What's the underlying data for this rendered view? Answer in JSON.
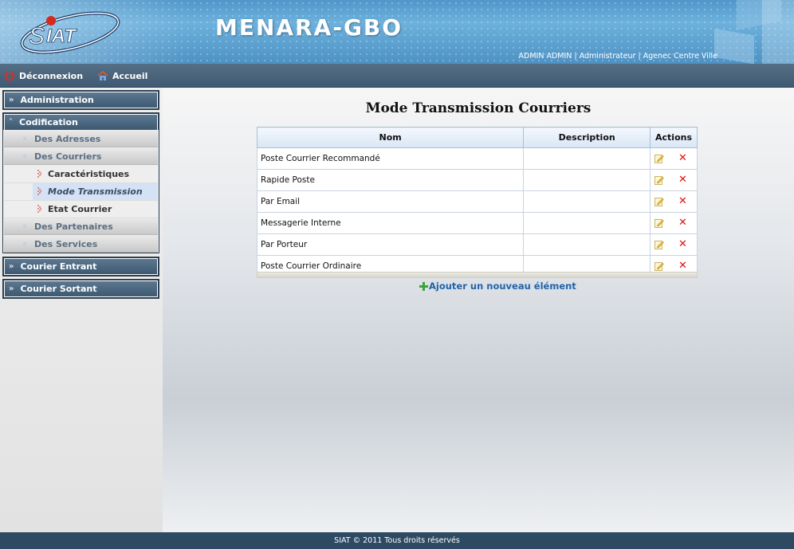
{
  "header": {
    "logo_text": "SIAT",
    "app_title": "MENARA-GBO",
    "user_info": "ADMIN ADMIN | Administrateur | Agenec Centre Ville"
  },
  "topbar": {
    "logout_label": "Déconnexion",
    "home_label": "Accueil"
  },
  "sidebar": {
    "sections": {
      "administration": "Administration",
      "codification": "Codification",
      "courier_entrant": "Courier Entrant",
      "courier_sortant": "Courier Sortant"
    },
    "codification_items": {
      "adresses": "Des Adresses",
      "courriers": "Des Courriers",
      "caracteristiques": "Caractéristiques",
      "mode_transmission": "Mode Transmission",
      "etat_courrier": "Etat Courrier",
      "partenaires": "Des Partenaires",
      "services": "Des Services"
    },
    "active_item": "Mode Transmission"
  },
  "main": {
    "title": "Mode Transmission Courriers",
    "columns": [
      "Nom",
      "Description",
      "Actions"
    ],
    "rows": [
      {
        "nom": "Poste Courrier Recommandé",
        "description": ""
      },
      {
        "nom": "Rapide Poste",
        "description": ""
      },
      {
        "nom": "Par Email",
        "description": ""
      },
      {
        "nom": "Messagerie Interne",
        "description": ""
      },
      {
        "nom": "Par Porteur",
        "description": ""
      },
      {
        "nom": "Poste Courrier Ordinaire",
        "description": ""
      }
    ],
    "add_label": "Ajouter un nouveau élément"
  },
  "footer": {
    "text": "SIAT © 2011 Tous droits réservés"
  },
  "colors": {
    "header_blue": "#5aa3d4",
    "bar_dark": "#3f5a72",
    "link_blue": "#2164a8",
    "delete_red": "#e01010"
  }
}
